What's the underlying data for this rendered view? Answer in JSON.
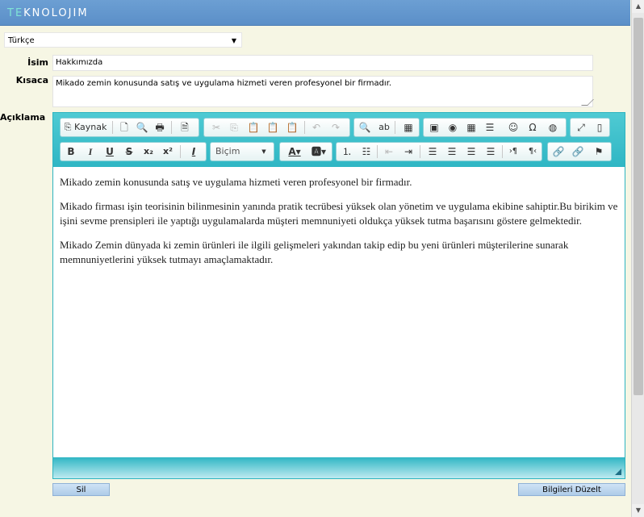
{
  "header": {
    "logo_prefix": "TE",
    "logo_rest": "KNOLOJIM"
  },
  "language": {
    "selected": "Türkçe"
  },
  "form": {
    "name_label": "İsim",
    "name_value": "Hakkımızda",
    "summary_label": "Kısaca",
    "summary_value": "Mikado zemin konusunda satış ve uygulama hizmeti veren profesyonel bir  firmadır.",
    "description_label": "Açıklama"
  },
  "editor": {
    "source_label": "Kaynak",
    "format_label": "Biçim",
    "paragraphs": [
      "Mikado zemin konusunda satış ve uygulama hizmeti veren profesyonel bir  firmadır.",
      "Mikado firması işin teorisinin bilinmesinin yanında pratik tecrübesi yüksek olan yönetim ve uygulama ekibine sahiptir.Bu birikim ve işini sevme prensipleri ile yaptığı uygulamalarda müşteri memnuniyeti oldukça yüksek tutma başarısını göstere gelmektedir.",
      "Mikado Zemin dünyada ki zemin ürünleri ile ilgili gelişmeleri yakından takip edip bu yeni ürünleri müşterilerine sunarak memnuniyetlerini yüksek tutmayı amaçlamaktadır."
    ]
  },
  "buttons": {
    "delete": "Sil",
    "update": "Bilgileri Düzelt"
  },
  "colors": {
    "header": "#5b8fc8",
    "editor_chrome": "#2fb6c4",
    "background": "#f6f6e4"
  }
}
